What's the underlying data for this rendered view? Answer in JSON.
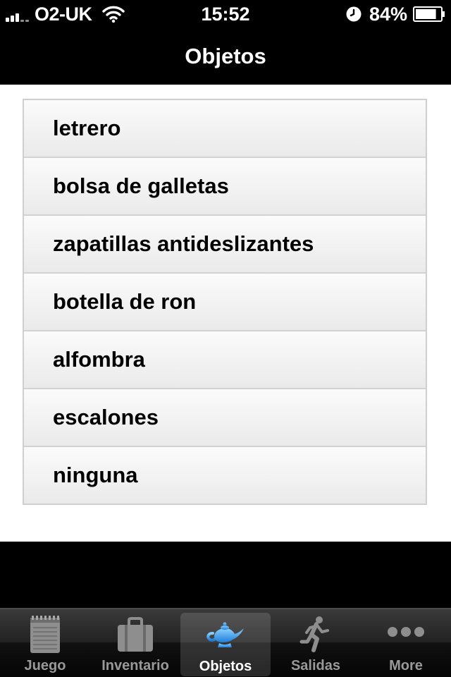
{
  "status_bar": {
    "carrier": "O2-UK",
    "time": "15:52",
    "battery": "84%",
    "battery_level": 0.84,
    "signal_icon": "signal-bars-icon",
    "wifi_icon": "wifi-icon",
    "clock_icon": "clock-icon"
  },
  "nav": {
    "title": "Objetos"
  },
  "objects": [
    {
      "label": "letrero"
    },
    {
      "label": "bolsa de galletas"
    },
    {
      "label": "zapatillas antideslizantes"
    },
    {
      "label": "botella de ron"
    },
    {
      "label": "alfombra"
    },
    {
      "label": "escalones"
    },
    {
      "label": "ninguna"
    }
  ],
  "tabs": [
    {
      "label": "Juego",
      "icon": "notepad-icon"
    },
    {
      "label": "Inventario",
      "icon": "suitcase-icon"
    },
    {
      "label": "Objetos",
      "icon": "magic-lamp-icon",
      "selected": true
    },
    {
      "label": "Salidas",
      "icon": "running-man-icon"
    },
    {
      "label": "More",
      "icon": "more-dots-icon"
    }
  ],
  "colors": {
    "selected_icon": "#3d9ee8",
    "inactive_icon": "#8e8e8e",
    "background": "#000000"
  }
}
